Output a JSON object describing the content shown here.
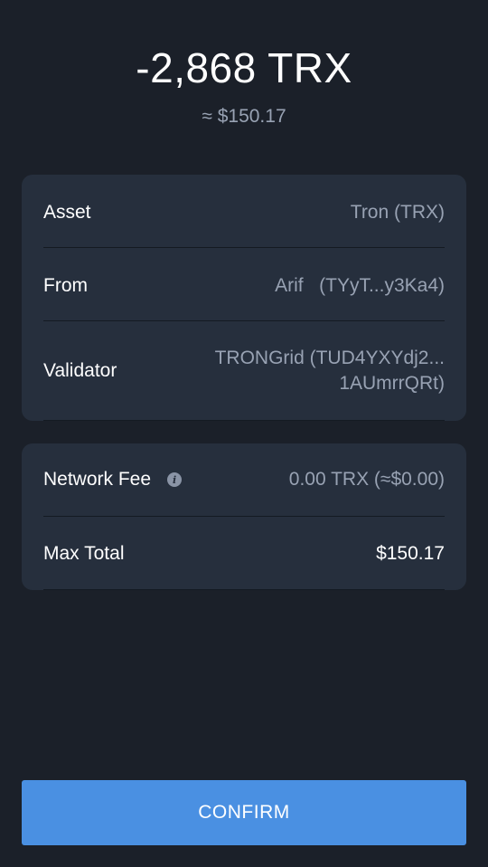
{
  "header": {
    "amount": "-2,868 TRX",
    "fiat_equivalent": "≈ $150.17"
  },
  "details": {
    "asset": {
      "label": "Asset",
      "value": "Tron (TRX)"
    },
    "from": {
      "label": "From",
      "value": "Arif   (TYyT...y3Ka4)"
    },
    "validator": {
      "label": "Validator",
      "value_line1": "TRONGrid (TUD4YXYdj2...",
      "value_line2": "1AUmrrQRt)"
    }
  },
  "fees": {
    "network_fee": {
      "label": "Network Fee",
      "info_icon": "info-icon",
      "value": "0.00 TRX (≈$0.00)"
    },
    "max_total": {
      "label": "Max Total",
      "value": "$150.17"
    }
  },
  "actions": {
    "confirm_label": "CONFIRM"
  },
  "colors": {
    "background": "#1b2029",
    "card": "#262f3d",
    "muted_text": "#98a2b3",
    "accent": "#4a90e2"
  }
}
